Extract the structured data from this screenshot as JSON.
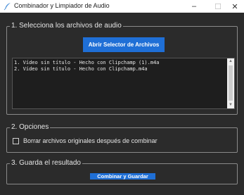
{
  "window": {
    "title": "Combinador y Limpiador de Audio",
    "app_icon": "feather-icon",
    "controls": {
      "minimize": "–",
      "maximize": "☐",
      "close": "✕"
    }
  },
  "section_files": {
    "legend": "1. Selecciona los archivos de audio",
    "open_button_label": "Abrir Selector de Archivos",
    "files": [
      "1. Vídeo sin título - Hecho con Clipchamp (1).m4a",
      "2. Vídeo sin título - Hecho con Clipchamp.m4a"
    ]
  },
  "section_options": {
    "legend": "2. Opciones",
    "delete_originals_label": "Borrar archivos originales después de combinar",
    "delete_originals_checked": false
  },
  "section_save": {
    "legend": "3. Guarda el resultado",
    "save_button_label": "Combinar y Guardar"
  },
  "colors": {
    "background": "#2b2b2b",
    "accent": "#1f6fd6",
    "list_background": "#1e1e1e"
  }
}
